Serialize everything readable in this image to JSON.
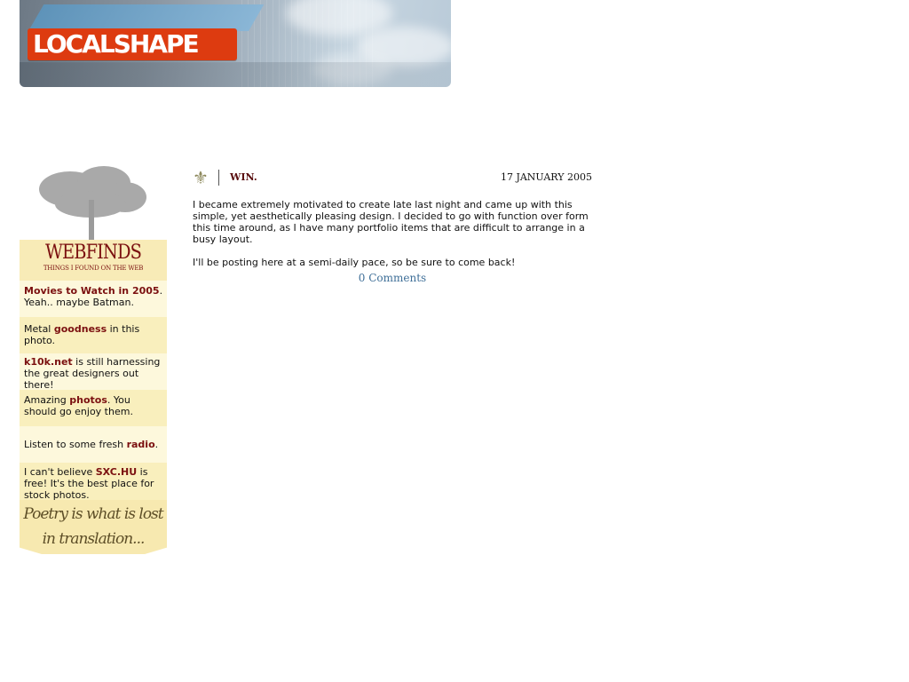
{
  "banner": {
    "logo": "LOCALSHAPE"
  },
  "sidebar": {
    "header_title": "WEBFINDS",
    "header_subtitle": "THINGS I FOUND ON THE WEB",
    "items": [
      {
        "link": "Movies to Watch in 2005",
        "after": ". Yeah.. maybe Batman."
      },
      {
        "before": "Metal ",
        "link": "goodness",
        "after": " in this photo."
      },
      {
        "link": "k10k.net",
        "after": " is still harnessing the great designers out there!"
      },
      {
        "before": "Amazing ",
        "link": "photos",
        "after": ". You should go enjoy them."
      },
      {
        "before": "Listen to some fresh ",
        "link": "radio",
        "after": "."
      },
      {
        "before": "I can't believe ",
        "link": "SXC.HU",
        "after": " is free! It's the best place for stock photos."
      }
    ],
    "poetry": "Poetry is what is lost in translation..."
  },
  "post": {
    "icon": "fleur-de-lis-icon",
    "title": "WIN.",
    "date": "17 JANUARY 2005",
    "paragraphs": [
      "I became extremely motivated to create late last night and came up with this simple, yet aesthetically pleasing design. I decided to go with function over form this time around, as I have many portfolio items that are difficult to arrange in a busy layout.",
      "I'll be posting here at a semi-daily pace, so be sure to come back!"
    ],
    "comments_link": "0 Comments"
  },
  "colors": {
    "accent_red": "#7b1010",
    "sidebar_bg": "#f8ebb7",
    "link_blue": "#3f6f98",
    "logo_red": "#dd3b10"
  }
}
